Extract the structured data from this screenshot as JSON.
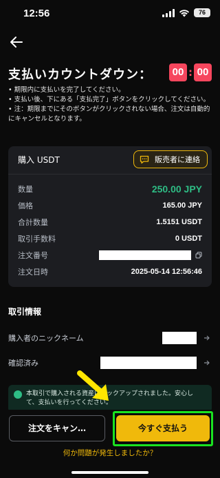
{
  "status_bar": {
    "time": "12:56",
    "battery": "76"
  },
  "header": {
    "title": "支払いカウントダウン：",
    "countdown_min": "00",
    "countdown_sep": ":",
    "countdown_sec": "00"
  },
  "notes": [
    "• 期限内に支払いを完了してください。",
    "• 支払い後、下にある「支払完了」ボタンをクリックしてください。",
    "• 注：期限までにそのボタンがクリックされない場合、注文は自動的にキャンセルとなります。"
  ],
  "order_card": {
    "title": "購入 USDT",
    "contact_label": "販売者に連絡",
    "rows": [
      {
        "label": "数量",
        "value": "250.00 JPY"
      },
      {
        "label": "価格",
        "value": "165.00 JPY"
      },
      {
        "label": "合計数量",
        "value": "1.5151 USDT"
      },
      {
        "label": "取引手数料",
        "value": "0 USDT"
      },
      {
        "label": "注文番号",
        "value": ""
      },
      {
        "label": "注文日時",
        "value": "2025-05-14 12:56:46"
      }
    ]
  },
  "trade_info": {
    "title": "取引情報",
    "buyer_nickname_label": "購入者のニックネーム",
    "confirmed_label": "確認済み"
  },
  "notice": {
    "text": "本取引で購入される資産はロックアップされました。安心して、支払いを行ってください。"
  },
  "footer": {
    "cancel_label": "注文をキャン…",
    "pay_label": "今すぐ支払う",
    "problem_link": "何か問題が発生しましたか？"
  },
  "colors": {
    "accent": "#f0b90b",
    "positive": "#2ebd85",
    "danger": "#f6465d",
    "highlight": "#1ae320"
  }
}
